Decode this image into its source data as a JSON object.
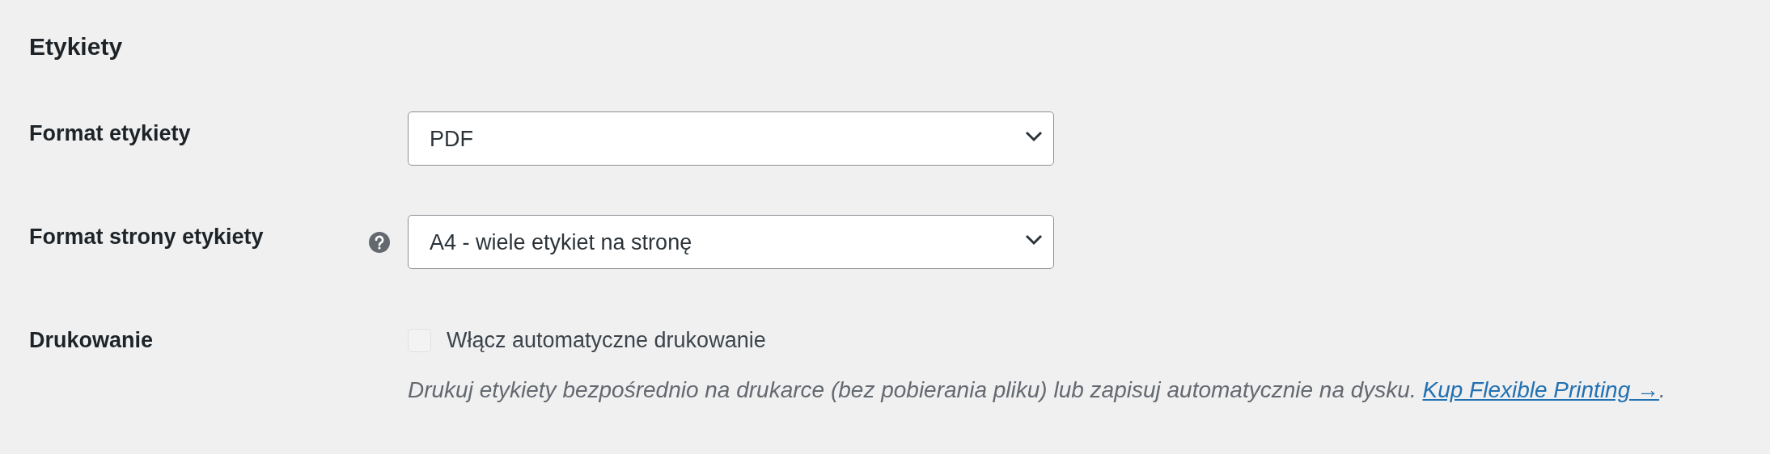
{
  "section": {
    "title": "Etykiety"
  },
  "fields": [
    {
      "kind": "select",
      "label": "Format etykiety",
      "help": false,
      "value": "PDF"
    },
    {
      "kind": "select",
      "label": "Format strony etykiety",
      "help": true,
      "value": "A4 - wiele etykiet na stronę"
    },
    {
      "kind": "checkbox",
      "label": "Drukowanie",
      "help": false,
      "option": "Włącz automatyczne drukowanie",
      "checked": false,
      "description": {
        "text": "Drukuj etykiety bezpośrednio na drukarce (bez pobierania pliku) lub zapisuj automatycznie na dysku. ",
        "link": "Kup Flexible Printing →",
        "suffix": "."
      }
    }
  ]
}
